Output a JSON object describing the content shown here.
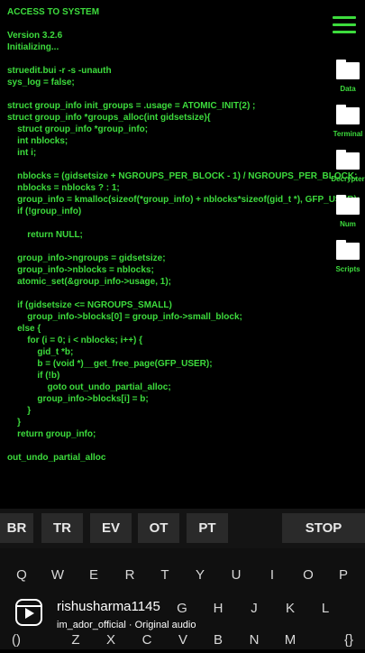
{
  "terminal": {
    "lines": [
      "ACCESS TO SYSTEM",
      "Version 3.2.6",
      "Initializing...",
      "struedit.bui -r -s -unauth",
      "sys_log = false;",
      "struct group_info init_groups = .usage = ATOMIC_INIT(2) ;",
      "struct group_info *groups_alloc(int gidsetsize){",
      "    struct group_info *group_info;",
      "    int nblocks;",
      "    int i;",
      "    nblocks = (gidsetsize + NGROUPS_PER_BLOCK - 1) / NGROUPS_PER_BLOCK;",
      "    nblocks = nblocks ? : 1;",
      "    group_info = kmalloc(sizeof(*group_info) + nblocks*sizeof(gid_t *), GFP_USER);",
      "    if (!group_info)",
      "        return NULL;",
      "    group_info->ngroups = gidsetsize;",
      "    group_info->nblocks = nblocks;",
      "    atomic_set(&group_info->usage, 1);",
      "    if (gidsetsize <= NGROUPS_SMALL)",
      "        group_info->blocks[0] = group_info->small_block;",
      "    else {",
      "        for (i = 0; i < nblocks; i++) {",
      "            gid_t *b;",
      "            b = (void *)__get_free_page(GFP_USER);",
      "            if (!b)",
      "                goto out_undo_partial_alloc;",
      "            group_info->blocks[i] = b;",
      "        }",
      "    }",
      "    return group_info;",
      "out_undo_partial_alloc"
    ]
  },
  "menu_icon": "hamburger-menu-icon",
  "side_folders": [
    {
      "label": "Data",
      "icon": "folder-icon"
    },
    {
      "label": "Terminal",
      "icon": "folder-icon"
    },
    {
      "label": "Decrypter",
      "icon": "folder-icon"
    },
    {
      "label": "Num",
      "icon": "folder-icon"
    },
    {
      "label": "Scripts",
      "icon": "folder-icon"
    }
  ],
  "commands": [
    "BR",
    "TR",
    "EV",
    "OT",
    "PT"
  ],
  "stop_label": "STOP",
  "keyboard": {
    "row1": [
      "Q",
      "W",
      "E",
      "R",
      "T",
      "Y",
      "U",
      "I",
      "O",
      "P"
    ],
    "row2_visible": [
      "G",
      "H",
      "J",
      "K",
      "L"
    ],
    "row3_visible": [
      "()",
      "Z",
      "X",
      "C",
      "V",
      "B",
      "N",
      "M",
      "{}"
    ]
  },
  "overlay": {
    "username": "rishusharma1145",
    "audio": "im_ador_official · Original audio",
    "icon": "reels-icon"
  },
  "colors": {
    "accent": "#3ddc3d",
    "background": "#000000"
  }
}
